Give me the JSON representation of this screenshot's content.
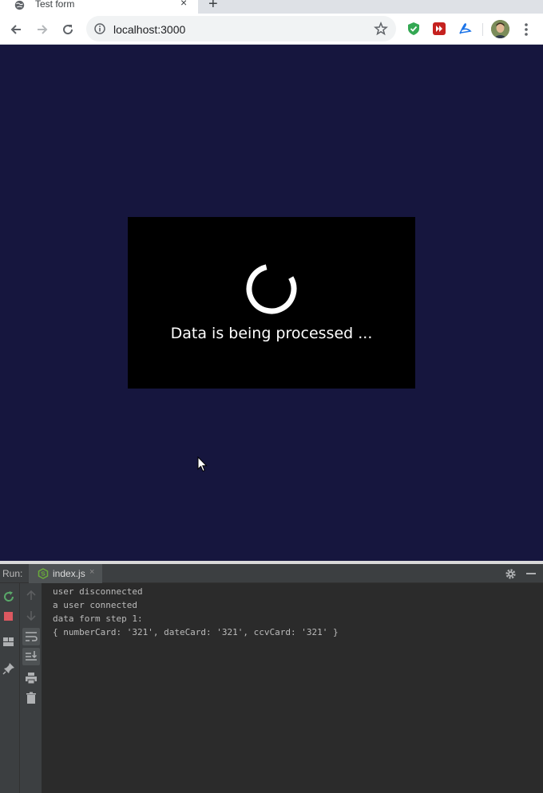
{
  "browser": {
    "tab_title": "Test form",
    "tab_close": "×",
    "new_tab": "+",
    "url": "localhost:3000"
  },
  "page": {
    "background_color": "#16163e",
    "modal": {
      "message": "Data is being processed ..."
    }
  },
  "ide": {
    "run_label": "Run:",
    "run_tab_label": "index.js",
    "run_tab_close": "×",
    "console_lines": [
      "user disconnected",
      "a user connected",
      "data form step 1:",
      "{ numberCard: '321', dateCard: '321', ccvCard: '321' }"
    ]
  }
}
